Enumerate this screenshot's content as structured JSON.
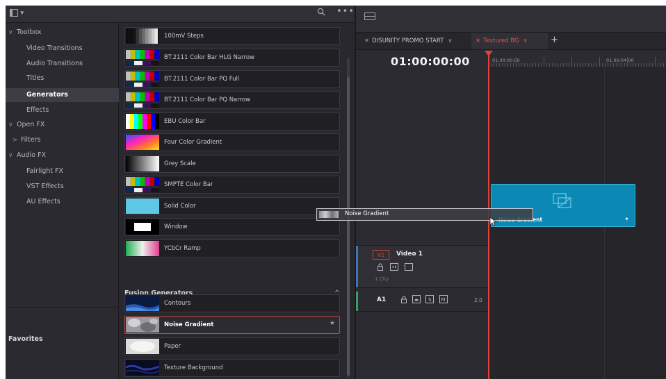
{
  "topbar": {
    "panel_toggle": "▾",
    "search_icon": "search-icon",
    "more": "•••"
  },
  "sidebar": {
    "items": [
      {
        "label": "Toolbox",
        "chevron": "∨",
        "indent": 0
      },
      {
        "label": "Video Transitions",
        "chevron": "",
        "indent": 2
      },
      {
        "label": "Audio Transitions",
        "chevron": "",
        "indent": 2
      },
      {
        "label": "Titles",
        "chevron": "",
        "indent": 2
      },
      {
        "label": "Generators",
        "chevron": "",
        "indent": 2,
        "selected": true
      },
      {
        "label": "Effects",
        "chevron": "",
        "indent": 2
      },
      {
        "label": "Open FX",
        "chevron": "∨",
        "indent": 0
      },
      {
        "label": "Filters",
        "chevron": ">",
        "indent": 1
      },
      {
        "label": "Audio FX",
        "chevron": "∨",
        "indent": 0
      },
      {
        "label": "Fairlight FX",
        "chevron": "",
        "indent": 2
      },
      {
        "label": "VST Effects",
        "chevron": "",
        "indent": 2
      },
      {
        "label": "AU Effects",
        "chevron": "",
        "indent": 2
      }
    ],
    "favorites": "Favorites"
  },
  "generators": [
    {
      "label": "100mV Steps",
      "thumb": "steps"
    },
    {
      "label": "BT.2111 Color Bar HLG Narrow",
      "thumb": "bars"
    },
    {
      "label": "BT.2111 Color Bar PQ Full",
      "thumb": "bars"
    },
    {
      "label": "BT.2111 Color Bar PQ Narrow",
      "thumb": "bars"
    },
    {
      "label": "EBU Color Bar",
      "thumb": "ebu"
    },
    {
      "label": "Four Color Gradient",
      "thumb": "four"
    },
    {
      "label": "Grey Scale",
      "thumb": "grey"
    },
    {
      "label": "SMPTE Color Bar",
      "thumb": "smpte"
    },
    {
      "label": "Solid Color",
      "thumb": "solid"
    },
    {
      "label": "Window",
      "thumb": "window"
    },
    {
      "label": "YCbCr Ramp",
      "thumb": "ycbcr"
    }
  ],
  "fusion": {
    "heading": "Fusion Generators",
    "caret": "^",
    "items": [
      {
        "label": "Contours",
        "thumb": "contours"
      },
      {
        "label": "Noise Gradient",
        "thumb": "noise",
        "active": true,
        "star": "★"
      },
      {
        "label": "Paper",
        "thumb": "paper"
      },
      {
        "label": "Texture Background",
        "thumb": "texture"
      }
    ]
  },
  "timeline": {
    "tabs": [
      {
        "label": "DISUNITY PROMO START",
        "close": "✕",
        "dropdown": "∨",
        "active": false
      },
      {
        "label": "Textured BG",
        "close": "✕",
        "dropdown": "∨",
        "active": true
      }
    ],
    "add_tab": "+",
    "timecode": "01:00:00:00",
    "ruler": [
      "01:00:00:00",
      "01:00:04:00"
    ],
    "v1": {
      "badge": "V1",
      "name": "Video 1",
      "count": "1 Clip"
    },
    "a1": {
      "name": "A1",
      "solo": "S",
      "mute": "M",
      "level": "2.0"
    },
    "clip": {
      "name": "Noise Gradient"
    },
    "drag_ghost": "Noise Gradient"
  },
  "colors": {
    "accent_red": "#e0413a",
    "clip_blue": "#0b88b4",
    "video_track": "#3c78b8",
    "audio_track": "#3a9f63"
  }
}
